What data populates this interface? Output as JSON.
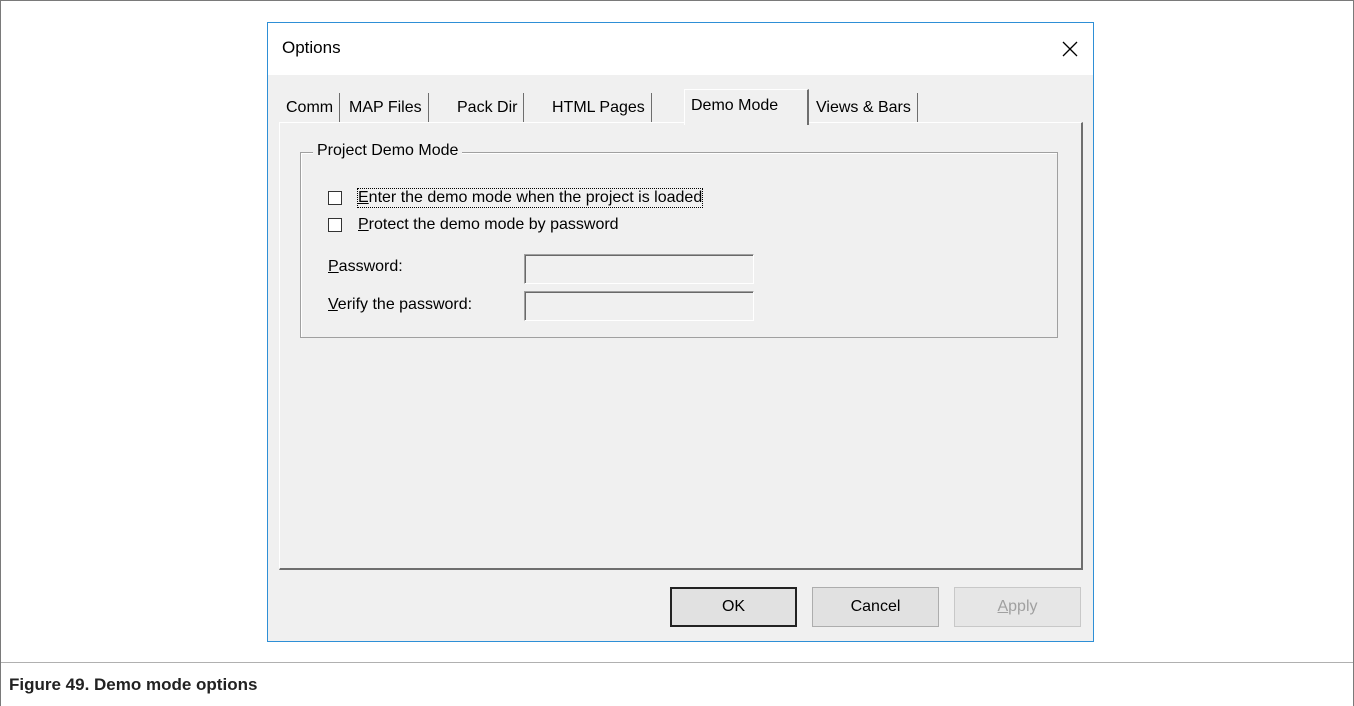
{
  "dialog": {
    "title": "Options",
    "close_icon": "close-icon"
  },
  "tabs": [
    {
      "label": "Comm",
      "active": false
    },
    {
      "label": "MAP Files",
      "active": false
    },
    {
      "label": "Pack Dir",
      "active": false
    },
    {
      "label": "HTML Pages",
      "active": false
    },
    {
      "label": "Demo Mode",
      "active": true
    },
    {
      "label": "Views & Bars",
      "active": false
    }
  ],
  "group": {
    "title": "Project Demo Mode",
    "checkbox_enter": {
      "mnemonic": "E",
      "rest": "nter the demo mode when the project is loaded",
      "checked": false
    },
    "checkbox_protect": {
      "mnemonic": "P",
      "rest": "rotect the demo mode by password",
      "checked": false
    },
    "password": {
      "mnemonic": "P",
      "rest": "assword:",
      "value": ""
    },
    "verify": {
      "mnemonic": "V",
      "rest": "erify the password:",
      "value": ""
    }
  },
  "buttons": {
    "ok": "OK",
    "cancel": "Cancel",
    "apply_mnemonic": "A",
    "apply_rest": "pply"
  },
  "caption": "Figure 49. Demo mode options"
}
